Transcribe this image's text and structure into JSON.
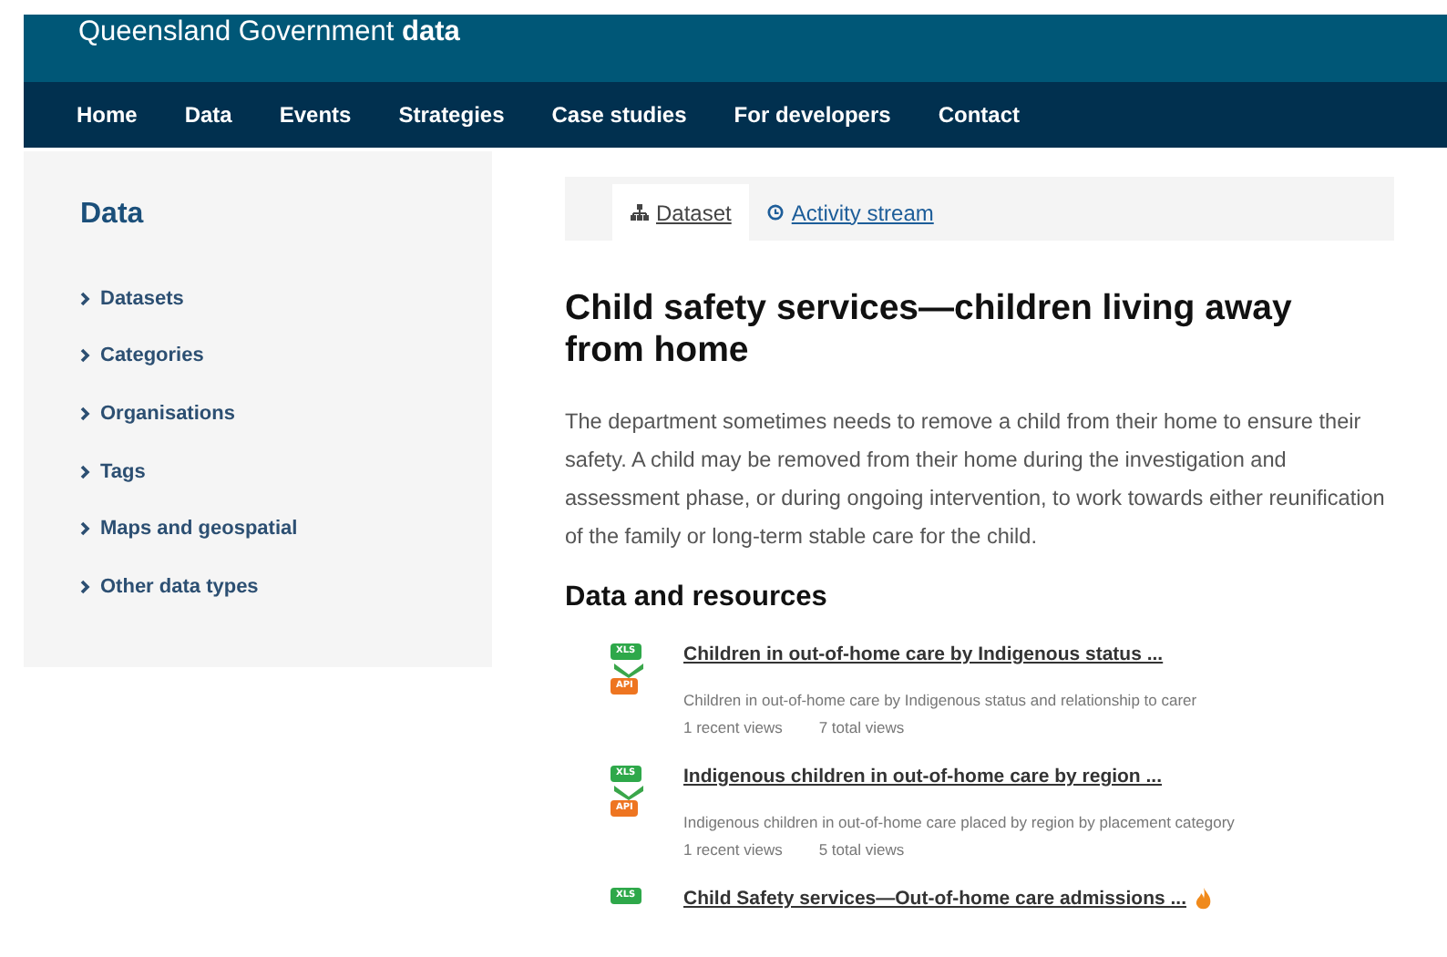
{
  "site_title": {
    "prefix": "Queensland Government",
    "bold": "data"
  },
  "nav": [
    "Home",
    "Data",
    "Events",
    "Strategies",
    "Case studies",
    "For developers",
    "Contact"
  ],
  "sidebar": {
    "heading": "Data",
    "items": [
      "Datasets",
      "Categories",
      "Organisations",
      "Tags",
      "Maps and geospatial",
      "Other data types"
    ]
  },
  "tabs": [
    {
      "label": "Dataset",
      "kind": "sitemap",
      "selected": true
    },
    {
      "label": "Activity stream",
      "kind": "clock",
      "selected": false
    }
  ],
  "title": "Child safety services—children living away from home",
  "description": "The department sometimes needs to remove a child from their home to ensure their safety. A child may be removed from their home during the investigation and assessment phase, or during ongoing intervention, to work towards either reunification of the family or long-term stable care for the child.",
  "resources_heading": "Data and resources",
  "resources": [
    {
      "title": "Children in out-of-home care by Indigenous status ...",
      "formats": [
        "XLS",
        "API"
      ],
      "description": "Children in out-of-home care by Indigenous status and relationship to carer",
      "recent": "1 recent views",
      "total": "7 total views",
      "hot": false
    },
    {
      "title": "Indigenous children in out-of-home care by region ...",
      "formats": [
        "XLS",
        "API"
      ],
      "description": "Indigenous children in out-of-home care placed by region by placement category",
      "recent": "1 recent views",
      "total": "5 total views",
      "hot": false
    },
    {
      "title": "Child Safety services—Out-of-home care admissions ...",
      "formats": [
        "XLS"
      ],
      "hot": true
    }
  ]
}
